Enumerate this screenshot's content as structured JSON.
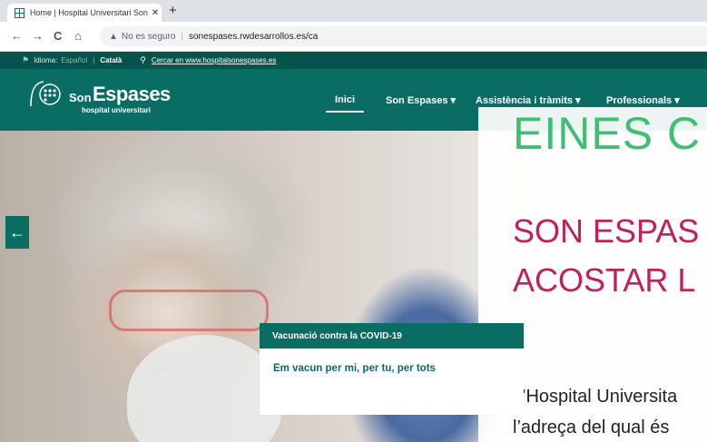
{
  "browser": {
    "tab_title": "Home | Hospital Universitari Son",
    "tab_close": "✕",
    "new_tab": "+",
    "back_icon": "←",
    "forward_icon": "→",
    "reload_icon": "C",
    "home_icon": "⌂",
    "security_icon": "▲",
    "security_text": "No es seguro",
    "url": "sonespases.rwdesarrollos.es/ca"
  },
  "topbar": {
    "lang_icon": "⚑",
    "lang_label": "Idioma:",
    "lang_es": "Español",
    "lang_ca": "Català",
    "search_icon": "⚲",
    "search_text": "Cercar en www.hospitalsonespases.es"
  },
  "header": {
    "logo_son": "Son",
    "logo_espases": "Espases",
    "logo_sub": "hospital universitari",
    "menu": [
      "Inici",
      "Son Espases ▾",
      "Assistència i tràmits ▾",
      "Professionals ▾"
    ]
  },
  "hero": {
    "prev_arrow": "←",
    "card_title": "Vacunació contra la COVID-19",
    "card_text": "Em vacun per mi, per tu, per tots"
  },
  "overlay": {
    "title": "EINES C",
    "subtitle_1": "SON ESPAS",
    "subtitle_2": "ACOSTAR L",
    "paragraph_1": "L’Hospital Universita",
    "paragraph_2": "l’adreça del qual és"
  },
  "colors": {
    "brand": "#0a6d64",
    "accent_green": "#3fbf72",
    "accent_pink": "#c31f5a"
  }
}
